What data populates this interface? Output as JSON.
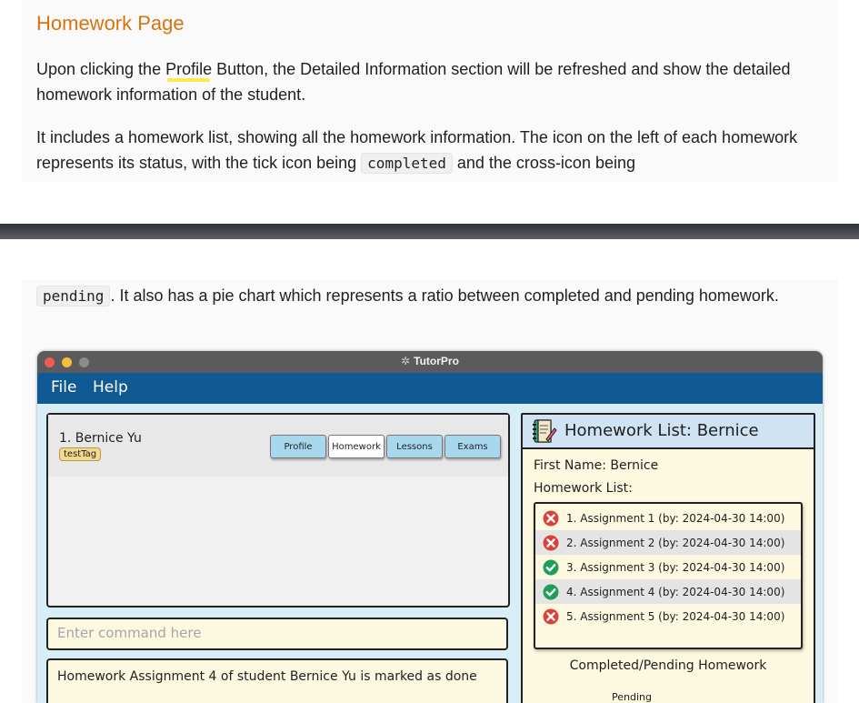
{
  "doc": {
    "title": "Homework Page",
    "p1_before": "Upon clicking the ",
    "p1_profile": "Profile",
    "p1_after": " Button, the Detailed Information section will be refreshed and show the detailed homework information of the student.",
    "p2_before": "It includes a homework list, showing all the homework information. The icon on the left of each homework represents its status, with the tick icon being ",
    "p2_code": "completed",
    "p2_after": " and the cross-icon being",
    "p3_code": "pending",
    "p3_after": ". It also has a pie chart which represents a ratio between completed and pending homework."
  },
  "app": {
    "window_title": "TutorPro",
    "menu": [
      "File",
      "Help"
    ],
    "person": {
      "name": "1.  Bernice Yu",
      "tag": "testTag"
    },
    "buttons": [
      "Profile",
      "Homework",
      "Lessons",
      "Exams"
    ],
    "command_placeholder": "Enter command here",
    "result": "Homework Assignment 4 of student Bernice Yu is marked as done",
    "detail": {
      "title": "Homework List: Bernice",
      "first_name": "First Name: Bernice",
      "list_label": "Homework List:",
      "items": [
        {
          "text": "1.  Assignment 1 (by: 2024-04-30 14:00)",
          "status": "pending"
        },
        {
          "text": "2.  Assignment 2 (by: 2024-04-30 14:00)",
          "status": "pending"
        },
        {
          "text": "3.  Assignment 3 (by: 2024-04-30 14:00)",
          "status": "completed"
        },
        {
          "text": "4.  Assignment 4 (by: 2024-04-30 14:00)",
          "status": "completed"
        },
        {
          "text": "5.  Assignment 5 (by: 2024-04-30 14:00)",
          "status": "pending"
        }
      ],
      "pie_title": "Completed/Pending Homework",
      "pie_legend": "Pending"
    }
  },
  "colors": {
    "heading": "#d9730d",
    "menubar": "#0f5a93",
    "tick": "#1f9e5a",
    "cross": "#d9413a"
  }
}
